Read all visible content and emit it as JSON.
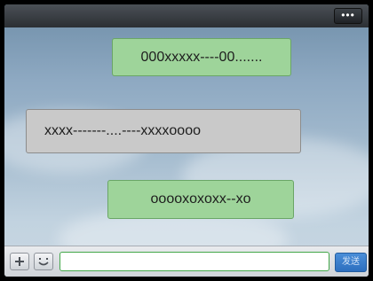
{
  "header": {
    "more_label": "•••"
  },
  "messages": [
    {
      "side": "right",
      "text": "000xxxxx----00......."
    },
    {
      "side": "left",
      "text": "xxxx-------....----xxxxoooo"
    },
    {
      "side": "right",
      "text": "ooooxoxoxx--xo"
    }
  ],
  "composer": {
    "plus_icon": "plus-icon",
    "emoji_icon": "smiley-icon",
    "input_value": "",
    "send_label": "发送"
  }
}
